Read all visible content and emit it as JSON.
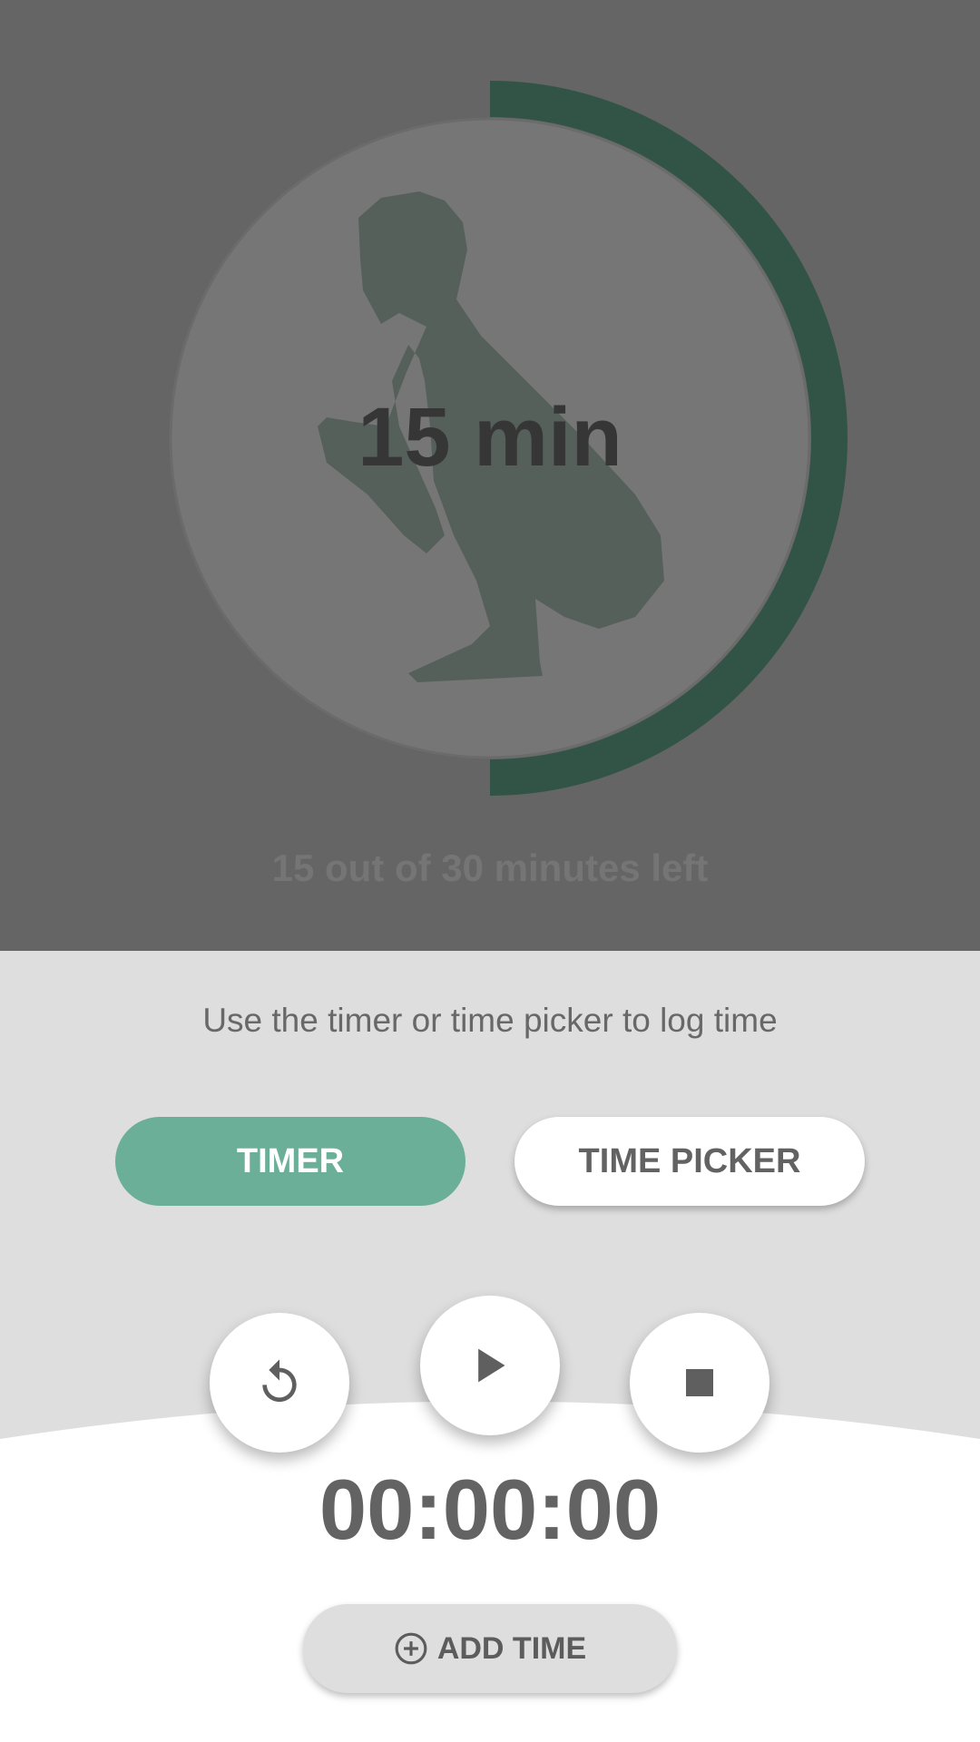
{
  "goal": {
    "center_label": "15 min",
    "remaining_label": "15 out of 30 minutes left",
    "progress_fraction": 0.5,
    "progress_color": "#325446",
    "illustration": "squatting-person-icon"
  },
  "controls": {
    "hint": "Use the timer or time picker to log time",
    "tabs": [
      {
        "label": "TIMER",
        "selected": true
      },
      {
        "label": "TIME PICKER",
        "selected": false
      }
    ],
    "buttons": {
      "reset": "reset-icon",
      "play": "play-icon",
      "stop": "stop-icon"
    },
    "clock": "00:00:00",
    "add_time_label": "ADD TIME",
    "accent_color": "#6caf98"
  }
}
